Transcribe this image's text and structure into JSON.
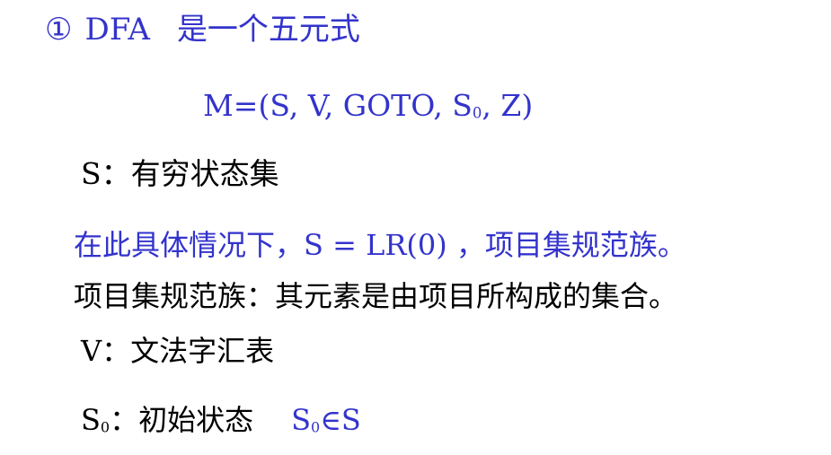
{
  "colors": {
    "blue_text": "#3333cc",
    "black_text": "#000000",
    "background": "#ffffff"
  },
  "line1": {
    "number": "①",
    "term": "DFA",
    "text": "是一个五元式"
  },
  "line2": {
    "formula_prefix": "M=(S,  V,   GOTO,   S",
    "sub": "0",
    "formula_suffix": ",   Z)"
  },
  "line3": {
    "text": "S：有穷状态集"
  },
  "line4": {
    "text": "在此具体情况下，S = LR(0) ，项目集规范族。"
  },
  "line5": {
    "text": "项目集规范族：其元素是由项目所构成的集合。"
  },
  "line6": {
    "text": "V：文法字汇表"
  },
  "line7": {
    "prefix": "S",
    "sub": "0",
    "label": "：初始状态",
    "expr_prefix": "S",
    "expr_sub": "0",
    "expr_suffix": "∈S"
  }
}
